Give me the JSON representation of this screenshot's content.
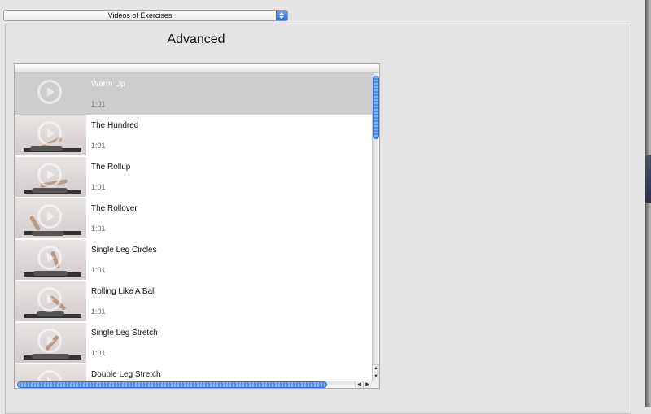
{
  "popup": {
    "selected": "Videos of Exercises"
  },
  "page": {
    "title": "Advanced"
  },
  "exercises": [
    {
      "title": "Warm Up",
      "duration": "1:01",
      "selected": true
    },
    {
      "title": "The Hundred",
      "duration": "1:01"
    },
    {
      "title": "The Rollup",
      "duration": "1:01"
    },
    {
      "title": "The Rollover",
      "duration": "1:01"
    },
    {
      "title": "Single Leg Circles",
      "duration": "1:01"
    },
    {
      "title": "Rolling Like A Ball",
      "duration": "1:01"
    },
    {
      "title": "Single Leg Stretch",
      "duration": "1:01"
    },
    {
      "title": "Double Leg Stretch",
      "duration": ""
    }
  ],
  "icons": {
    "popup_arrow": "up-down-arrows-icon",
    "thumbnail_overlay": "play-icon",
    "scroll_up": "arrow-up-icon",
    "scroll_down": "arrow-down-icon",
    "scroll_left": "arrow-left-icon",
    "scroll_right": "arrow-right-icon"
  },
  "colors": {
    "accent": "#4f8fe6",
    "selected_row": "#cdcdcd"
  },
  "scroll": {
    "vertical_position": 0,
    "horizontal_position": 0
  }
}
